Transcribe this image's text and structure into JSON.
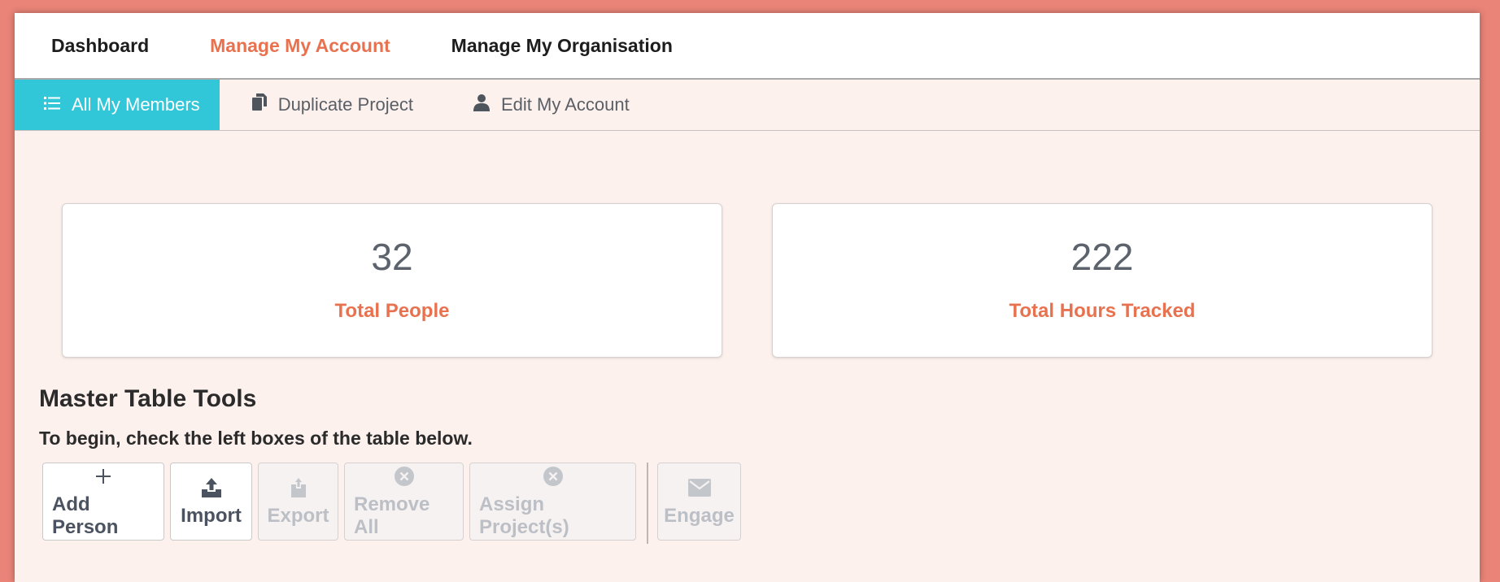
{
  "topnav": {
    "items": [
      "Dashboard",
      "Manage My Account",
      "Manage My Organisation"
    ],
    "active": "Manage My Account"
  },
  "subnav": {
    "items": [
      {
        "label": "All My Members",
        "icon": "list-icon",
        "active": true
      },
      {
        "label": "Duplicate Project",
        "icon": "copy-icon",
        "active": false
      },
      {
        "label": "Edit My Account",
        "icon": "user-icon",
        "active": false
      }
    ]
  },
  "stats": [
    {
      "value": "32",
      "label": "Total People"
    },
    {
      "value": "222",
      "label": "Total Hours Tracked"
    }
  ],
  "tools": {
    "title": "Master Table Tools",
    "hint": "To begin, check the left boxes of the table below.",
    "buttons": [
      {
        "label": "Add Person",
        "icon": "plus-icon",
        "enabled": true
      },
      {
        "label": "Import",
        "icon": "upload-icon",
        "enabled": true
      },
      {
        "label": "Export",
        "icon": "export-icon",
        "enabled": false
      },
      {
        "label": "Remove All",
        "icon": "circle-x-icon",
        "enabled": false
      },
      {
        "label": "Assign Project(s)",
        "icon": "circle-x-icon",
        "enabled": false
      },
      {
        "label": "Engage",
        "icon": "envelope-icon",
        "enabled": false
      }
    ]
  },
  "colors": {
    "accent": "#e8724f",
    "active_tab": "#31c7d9",
    "background": "#fdf1ee",
    "outer": "#ea8478"
  }
}
